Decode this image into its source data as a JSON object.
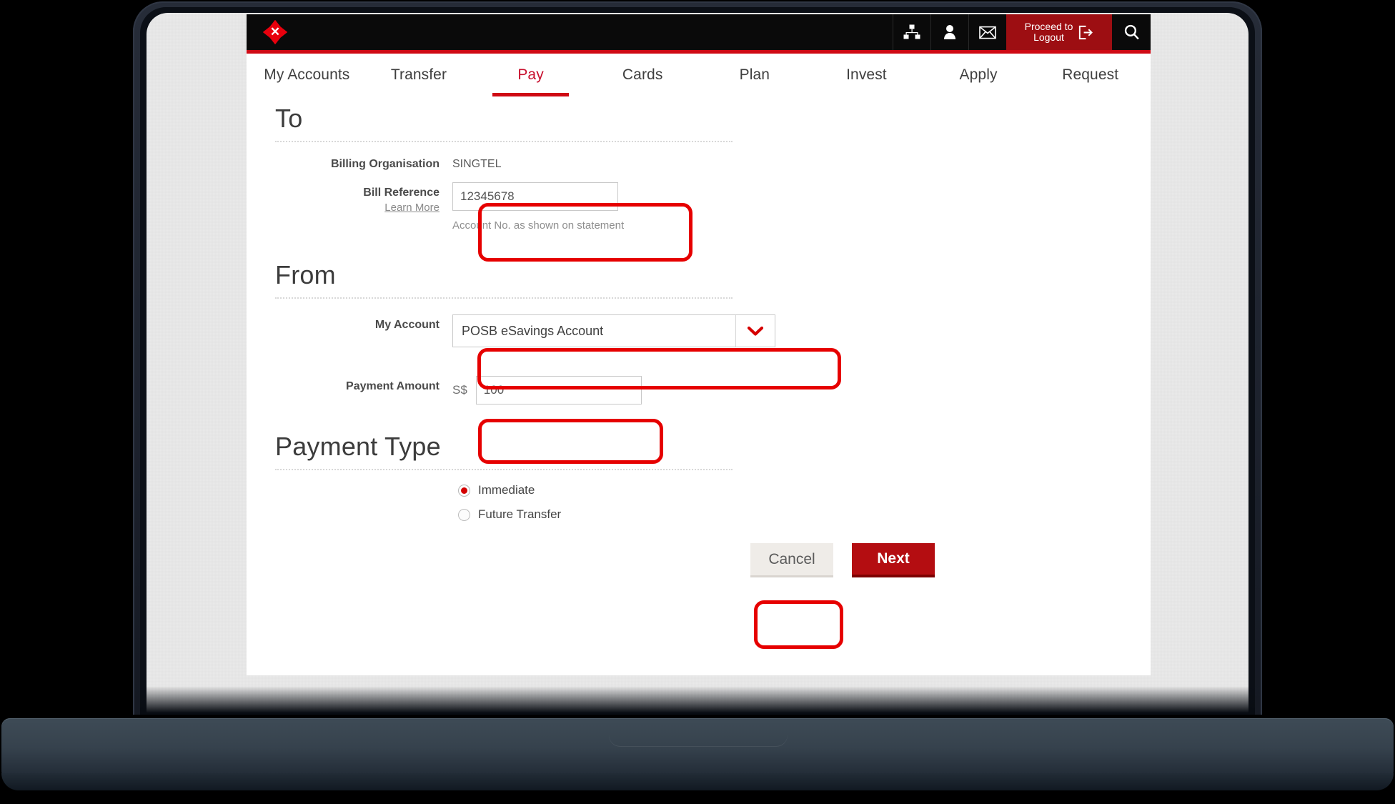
{
  "device": {
    "type": "laptop-mockup"
  },
  "topbar": {
    "logo_name": "dbs-logo",
    "icons": [
      {
        "name": "sitemap-icon",
        "title": "Site Map"
      },
      {
        "name": "person-icon",
        "title": "Profile"
      },
      {
        "name": "envelope-icon",
        "title": "Messages"
      }
    ],
    "logout_label_line1": "Proceed to",
    "logout_label_line2": "Logout",
    "logout_icon": "exit-icon",
    "search_icon": "search-icon",
    "rule_color": "#cf0a14",
    "background": "#0a0a0a"
  },
  "nav": {
    "items": [
      {
        "label": "My Accounts",
        "active": false
      },
      {
        "label": "Transfer",
        "active": false
      },
      {
        "label": "Pay",
        "active": true
      },
      {
        "label": "Cards",
        "active": false
      },
      {
        "label": "Plan",
        "active": false
      },
      {
        "label": "Invest",
        "active": false
      },
      {
        "label": "Apply",
        "active": false
      },
      {
        "label": "Request",
        "active": false
      }
    ],
    "active_color": "#c8102e"
  },
  "sections": {
    "to": {
      "title": "To",
      "billing_org_label": "Billing Organisation",
      "billing_org_value": "SINGTEL",
      "bill_ref_label": "Bill Reference",
      "bill_ref_learn_more": "Learn More",
      "bill_ref_value": "12345678",
      "bill_ref_hint": "Account No. as shown on statement"
    },
    "from": {
      "title": "From",
      "my_account_label": "My Account",
      "my_account_value": "POSB eSavings Account",
      "dropdown_icon": "chevron-down-icon",
      "payment_amount_label": "Payment Amount",
      "currency_prefix": "S$",
      "payment_amount_value": "100"
    },
    "payment_type": {
      "title": "Payment Type",
      "options": [
        {
          "label": "Immediate",
          "selected": true
        },
        {
          "label": "Future Transfer",
          "selected": false
        }
      ]
    }
  },
  "actions": {
    "cancel_label": "Cancel",
    "next_label": "Next",
    "next_color": "#b40d11"
  },
  "annotations": {
    "color": "#e60000",
    "boxes": [
      {
        "name": "bill-reference-highlight"
      },
      {
        "name": "my-account-highlight"
      },
      {
        "name": "payment-amount-highlight"
      },
      {
        "name": "next-button-highlight"
      }
    ]
  }
}
